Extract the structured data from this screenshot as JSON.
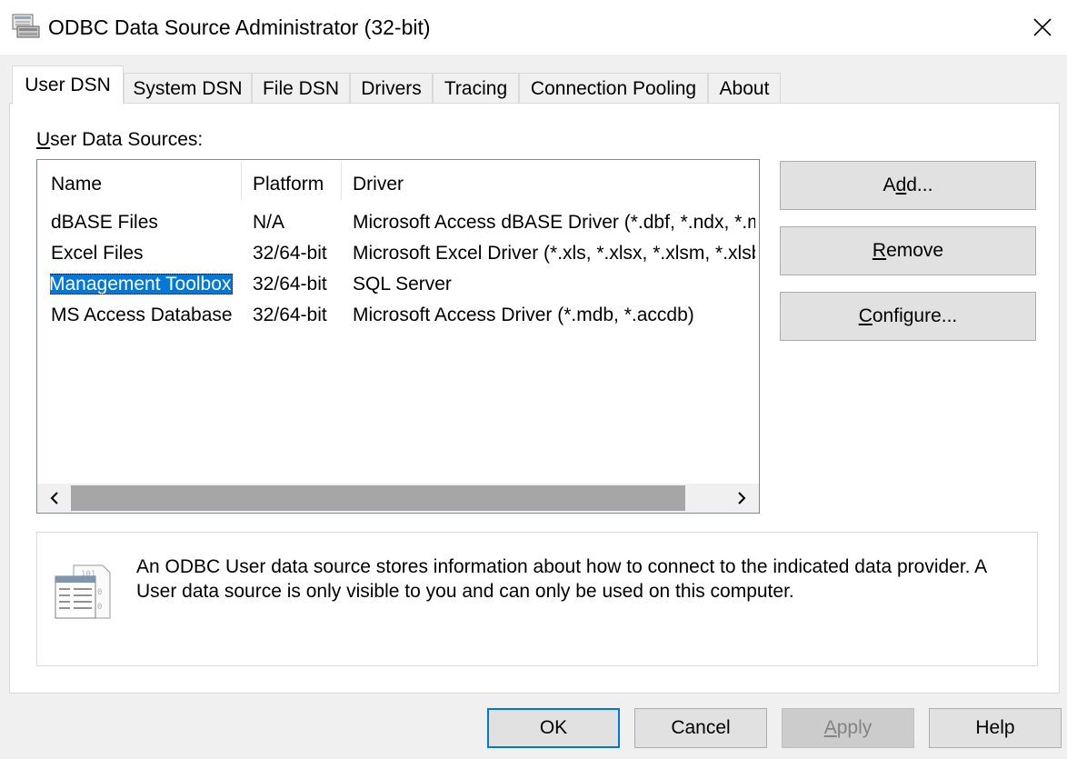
{
  "window": {
    "title": "ODBC Data Source Administrator (32-bit)"
  },
  "tabs": [
    {
      "label": "User DSN",
      "active": true
    },
    {
      "label": "System DSN",
      "active": false
    },
    {
      "label": "File DSN",
      "active": false
    },
    {
      "label": "Drivers",
      "active": false
    },
    {
      "label": "Tracing",
      "active": false
    },
    {
      "label": "Connection Pooling",
      "active": false
    },
    {
      "label": "About",
      "active": false
    }
  ],
  "user_dsn": {
    "section_label_mnemonic": "U",
    "section_label_rest": "ser Data Sources:",
    "columns": {
      "name": "Name",
      "platform": "Platform",
      "driver": "Driver"
    },
    "rows": [
      {
        "name": "dBASE Files",
        "platform": "N/A",
        "driver": "Microsoft Access dBASE Driver (*.dbf, *.ndx, *.mdx)",
        "selected": false
      },
      {
        "name": "Excel Files",
        "platform": "32/64-bit",
        "driver": "Microsoft Excel Driver (*.xls, *.xlsx, *.xlsm, *.xlsb)",
        "selected": false
      },
      {
        "name": "Management Toolbox",
        "platform": "32/64-bit",
        "driver": "SQL Server",
        "selected": true
      },
      {
        "name": "MS Access Database",
        "platform": "32/64-bit",
        "driver": "Microsoft Access Driver (*.mdb, *.accdb)",
        "selected": false
      }
    ],
    "buttons": {
      "add": {
        "pre": "A",
        "mn": "d",
        "post": "d..."
      },
      "remove": {
        "pre": "",
        "mn": "R",
        "post": "emove"
      },
      "configure": {
        "pre": "",
        "mn": "C",
        "post": "onfigure..."
      }
    },
    "info_text": "An ODBC User data source stores information about how to connect to the indicated data provider.   A User data source is only visible to you and can only be used on this computer."
  },
  "footer": {
    "ok": "OK",
    "cancel": "Cancel",
    "apply_mn": "A",
    "apply_rest": "pply",
    "apply_enabled": false,
    "help": "Help"
  },
  "colors": {
    "selection": "#0078d7",
    "button_face": "#e1e1e1",
    "button_border": "#adadad",
    "default_button_border": "#0078d7"
  },
  "icons": {
    "title": "odbc-admin-icon",
    "close": "close-icon",
    "info": "data-source-icon",
    "scroll_left": "chevron-left-icon",
    "scroll_right": "chevron-right-icon"
  }
}
